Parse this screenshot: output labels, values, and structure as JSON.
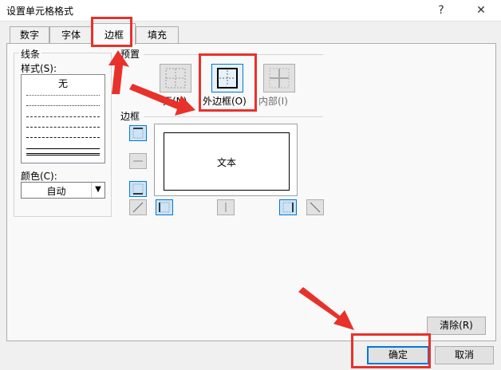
{
  "window": {
    "title": "设置单元格格式",
    "help": "?",
    "close": "✕"
  },
  "tabs": [
    {
      "label": "数字"
    },
    {
      "label": "字体"
    },
    {
      "label": "边框"
    },
    {
      "label": "填充"
    }
  ],
  "line_group": {
    "title": "线条",
    "style_label": "样式(S):",
    "none_item": "无",
    "color_label": "颜色(C):",
    "color_value": "自动"
  },
  "presets": {
    "title": "预置",
    "none_label": "无(N)",
    "outline_label": "外边框(O)",
    "inside_label": "内部(I)"
  },
  "border_group": {
    "title": "边框",
    "preview_text": "文本"
  },
  "buttons": {
    "clear": "清除(R)",
    "ok": "确定",
    "cancel": "取消"
  },
  "colors": {
    "annotation_red": "#e8312b",
    "accent": "#0078d7"
  }
}
